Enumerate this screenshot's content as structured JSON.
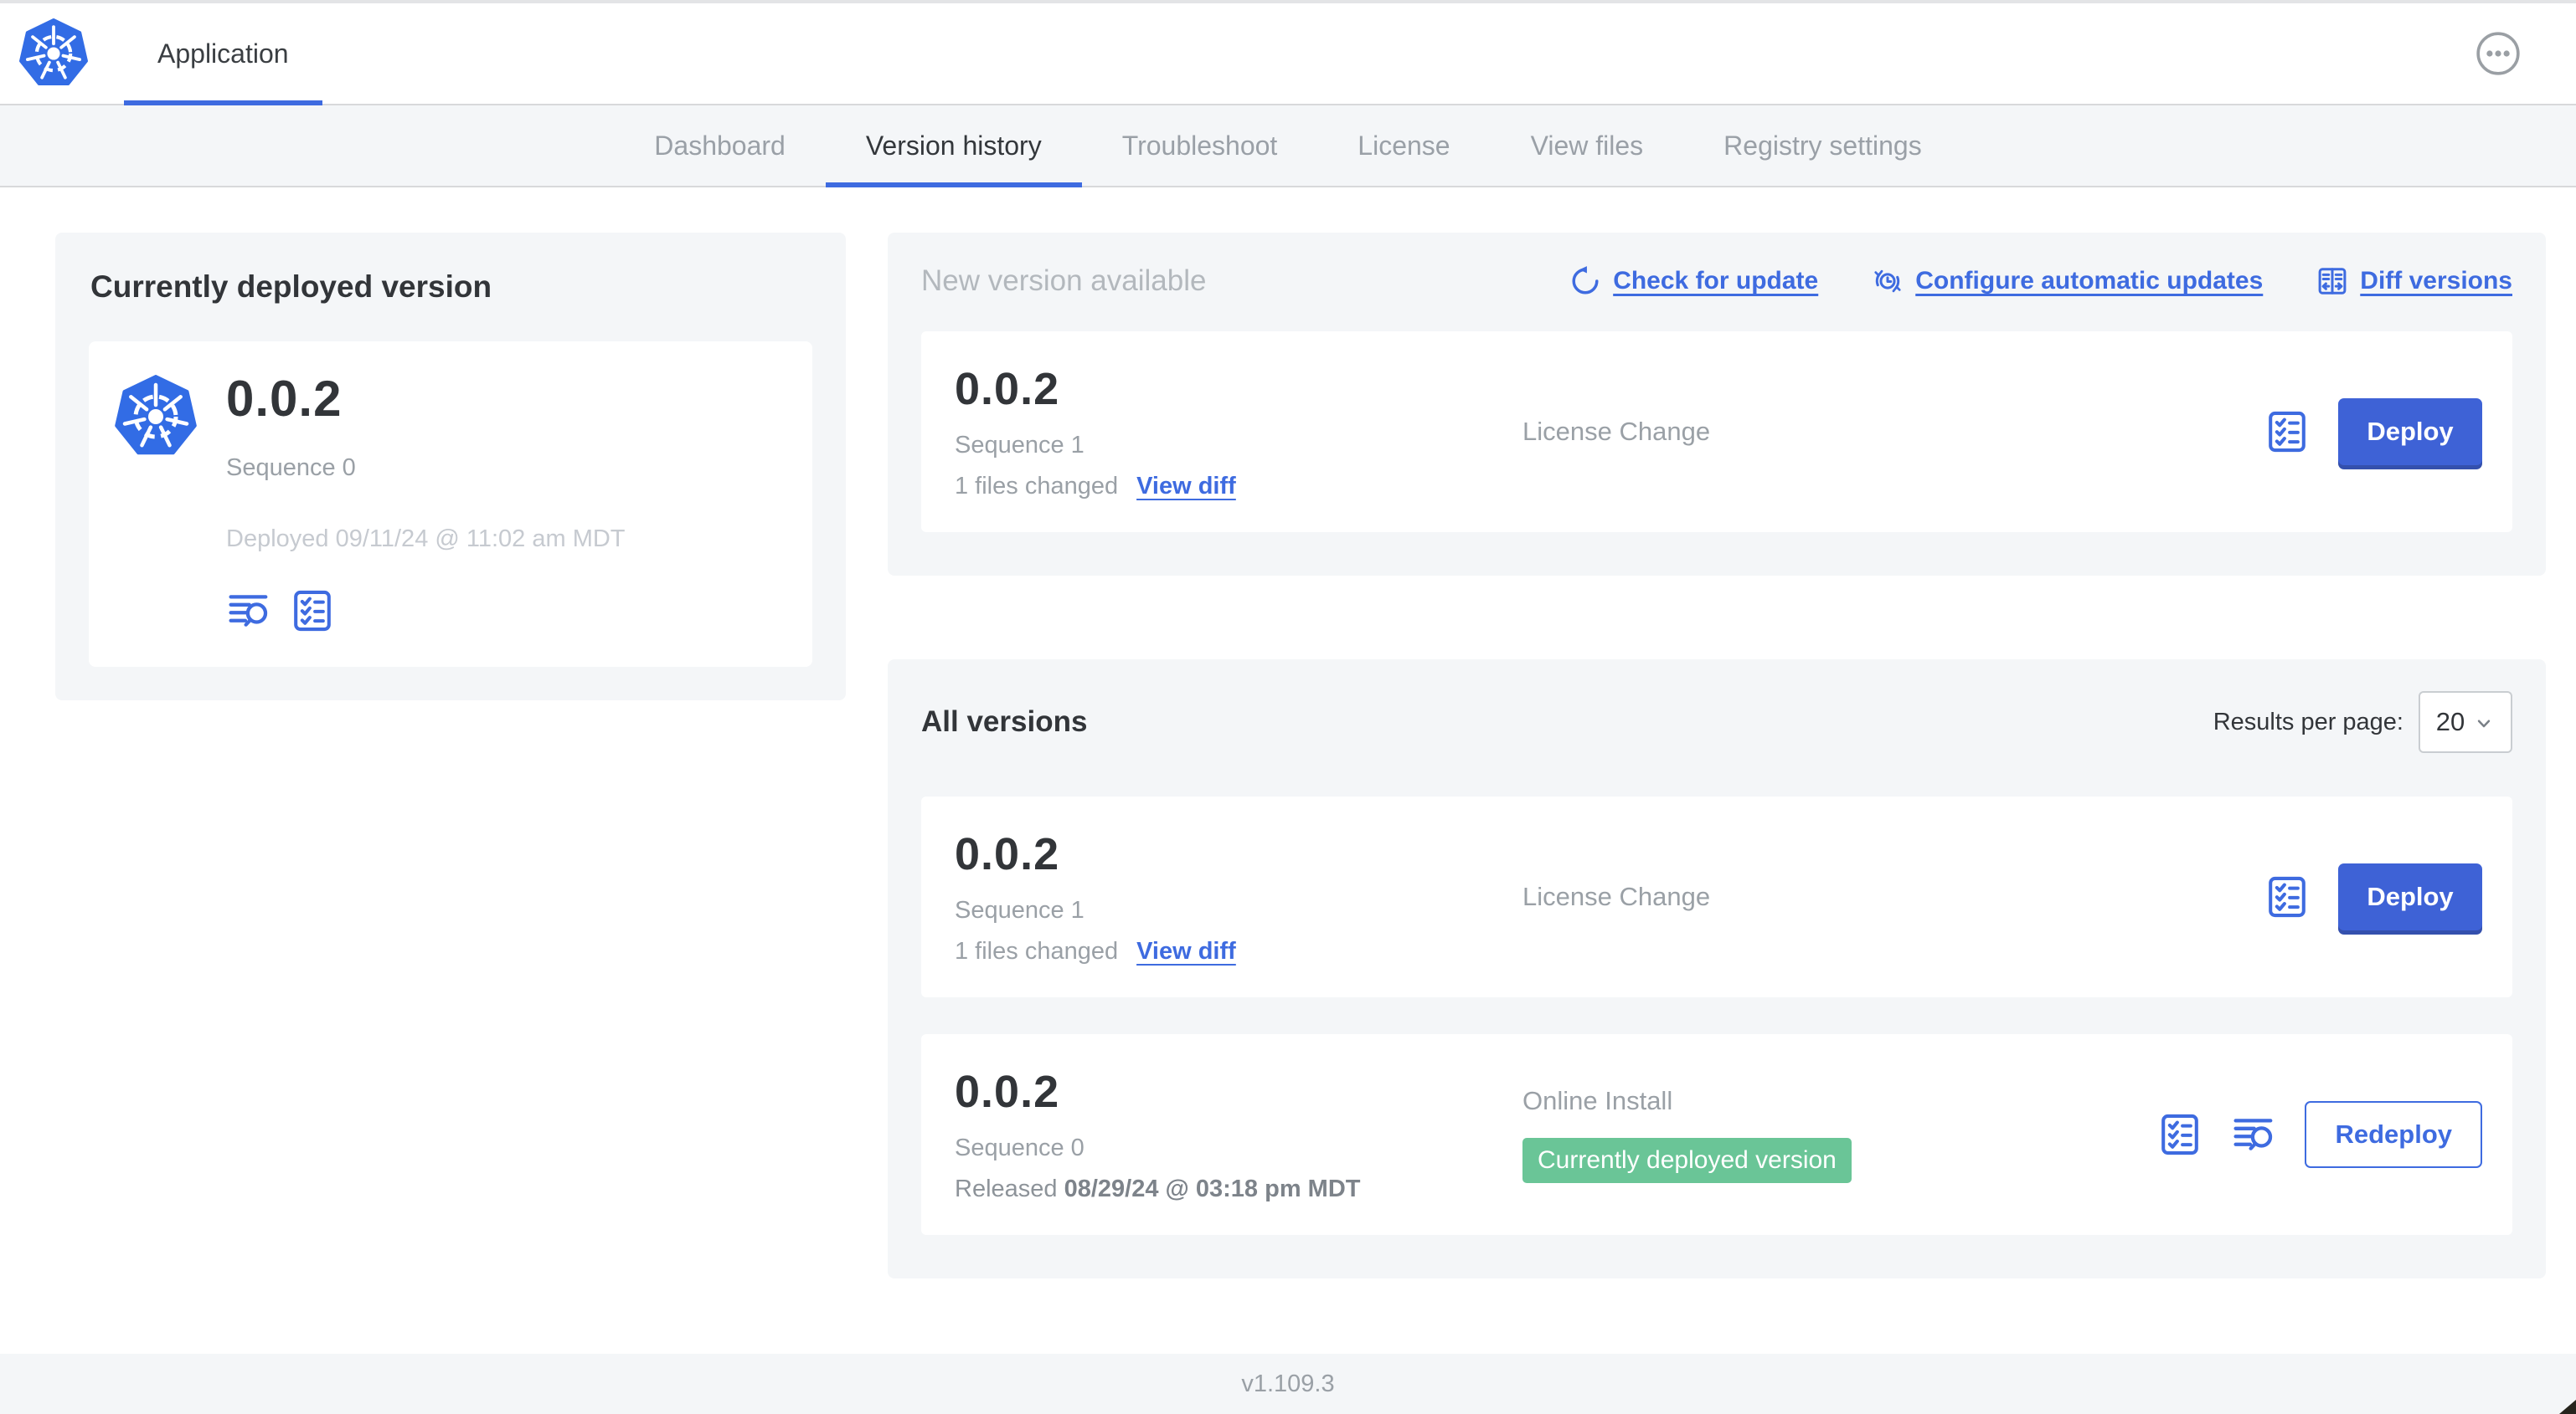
{
  "header": {
    "app_tab": "Application"
  },
  "nav": {
    "tabs": [
      {
        "label": "Dashboard",
        "active": false
      },
      {
        "label": "Version history",
        "active": true
      },
      {
        "label": "Troubleshoot",
        "active": false
      },
      {
        "label": "License",
        "active": false
      },
      {
        "label": "View files",
        "active": false
      },
      {
        "label": "Registry settings",
        "active": false
      }
    ]
  },
  "deployed_card": {
    "title": "Currently deployed version",
    "version": "0.0.2",
    "sequence": "Sequence 0",
    "deployed_at": "Deployed 09/11/24 @ 11:02 am MDT"
  },
  "new_version": {
    "title": "New version available",
    "actions": {
      "check_for_update": "Check for update",
      "configure_automatic_updates": "Configure automatic updates",
      "diff_versions": "Diff versions"
    },
    "row": {
      "version": "0.0.2",
      "sequence": "Sequence 1",
      "files_changed": "1 files changed",
      "view_diff": "View diff",
      "source": "License Change",
      "action": "Deploy"
    }
  },
  "all_versions": {
    "title": "All versions",
    "results_per_page_label": "Results per page:",
    "results_per_page_value": "20",
    "rows": [
      {
        "version": "0.0.2",
        "sequence": "Sequence 1",
        "files_changed": "1 files changed",
        "view_diff": "View diff",
        "source": "License Change",
        "action": "Deploy"
      },
      {
        "version": "0.0.2",
        "sequence": "Sequence 0",
        "released_prefix": "Released ",
        "released_date": "08/29/24 @ 03:18 pm MDT",
        "source": "Online Install",
        "badge": "Currently deployed version",
        "action": "Redeploy"
      }
    ]
  },
  "footer": {
    "version": "v1.109.3"
  },
  "icons": {
    "app_logo": "kubernetes-wheel",
    "header_menu": "ellipsis-circle",
    "check_for_update": "refresh-arrow",
    "configure_automatic_updates": "clock-refresh",
    "diff_versions": "diff-columns",
    "preflight_checks": "checklist",
    "deploy_logs": "log-search",
    "select_chevron": "chevron-down"
  },
  "colors": {
    "accent_blue": "#3e6be0",
    "logo_blue": "#326ce5",
    "badge_green": "#6ac597",
    "panel_bg": "#f4f6f8",
    "divider": "#d8d9db",
    "text_dark": "#323539",
    "text_gray": "#9aa0a6",
    "text_light": "#c6cad0"
  }
}
